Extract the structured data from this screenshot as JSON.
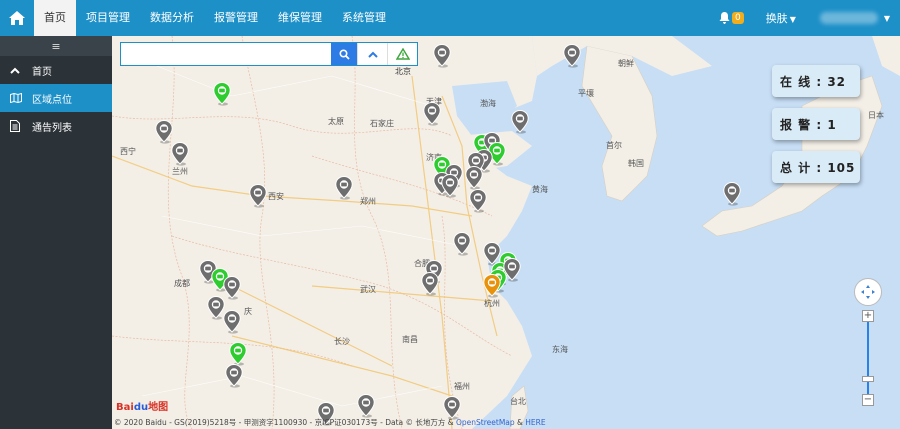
{
  "nav": {
    "items": [
      "首页",
      "项目管理",
      "数据分析",
      "报警管理",
      "维保管理",
      "系统管理"
    ],
    "active_index": 0
  },
  "topbar": {
    "alert_count": "0",
    "skin_label": "换肤"
  },
  "sidebar": {
    "toggle_icon": "≡",
    "items": [
      {
        "label": "首页",
        "icon": "chevron-up-icon"
      },
      {
        "label": "区域点位",
        "icon": "map-icon"
      },
      {
        "label": "通告列表",
        "icon": "document-icon"
      }
    ]
  },
  "search": {
    "placeholder": ""
  },
  "stats": {
    "online": "在 线 :  32",
    "alarm": "报 警 :  1",
    "total": "总 计 :  105"
  },
  "map_labels": {
    "beijing": "北京",
    "tianjin": "天津",
    "taiyuan": "太原",
    "shijiazhuang": "石家庄",
    "jinan": "济南",
    "zhengzhou": "郑州",
    "xian": "西安",
    "xining": "西宁",
    "lanzhou": "兰州",
    "hefei": "合肥",
    "wuhan": "武汉",
    "hangzhou": "杭州",
    "changsha": "长沙",
    "nanchang": "南昌",
    "fuzhou": "福州",
    "taibei": "台北",
    "chengdu": "成都",
    "chongqing": "庆",
    "bohai": "渤海",
    "huanghai": "黄海",
    "donghai": "东海",
    "pyongyang": "平壤",
    "korea": "韩国",
    "dprk": "朝鲜",
    "japan": "日本",
    "seoul": "首尔"
  },
  "copyright": {
    "text": "© 2020 Baidu - GS(2019)5218号 - 甲测资字1100930 - 京ICP证030173号 - Data © 长地万方 & ",
    "osm": "OpenStreetMap",
    "amp": " & ",
    "here": "HERE"
  },
  "logo": {
    "bai": "Bai",
    "paw": "du",
    "rest": "地图"
  },
  "colors": {
    "header": "#1e90c8",
    "sidebar": "#2b3238",
    "pin_gray": "#6e6e6e",
    "pin_green": "#2ecc2e",
    "pin_orange": "#e8920c",
    "sea": "#c7def5"
  }
}
